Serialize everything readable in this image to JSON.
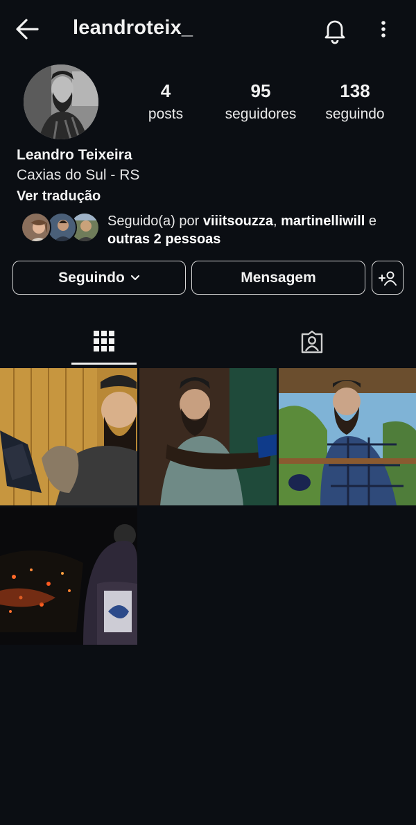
{
  "header": {
    "username": "leandroteix_",
    "back_icon": "arrow-left-icon",
    "bell_icon": "bell-icon",
    "menu_icon": "more-vertical-icon"
  },
  "stats": [
    {
      "value": "4",
      "label": "posts"
    },
    {
      "value": "95",
      "label": "seguidores"
    },
    {
      "value": "138",
      "label": "seguindo"
    }
  ],
  "bio": {
    "name": "Leandro Teixeira",
    "location": "Caxias do Sul - RS",
    "translate": "Ver tradução"
  },
  "followed_by": {
    "prefix": "Seguido(a) por ",
    "user1": "viiitsouzza",
    "sep": ", ",
    "user2": "martinelliwill",
    "and": " e",
    "others": "outras 2 pessoas"
  },
  "actions": {
    "following_label": "Seguindo",
    "message_label": "Mensagem",
    "add_user_icon": "add-person-icon"
  },
  "tabs": {
    "grid_icon": "grid-icon",
    "tagged_icon": "tagged-person-icon",
    "active": "grid"
  },
  "posts": [
    {
      "subject": "reading-book-with-cat"
    },
    {
      "subject": "playing-guitar"
    },
    {
      "subject": "balcony-with-mug"
    },
    {
      "subject": "night-city-view"
    }
  ],
  "colors": {
    "background": "#0b0e13",
    "text": "#f2f2f2",
    "border": "#d8d8d8"
  }
}
